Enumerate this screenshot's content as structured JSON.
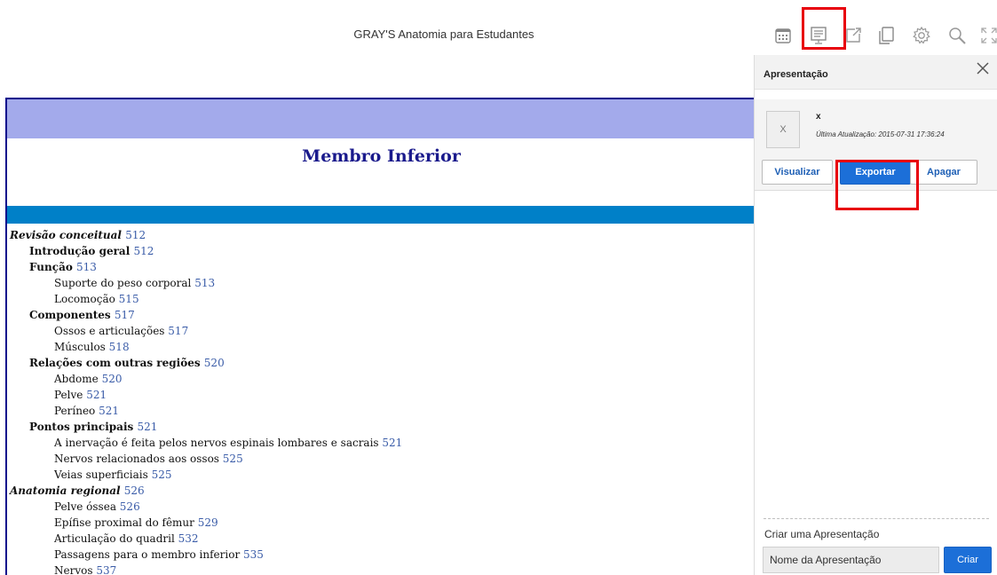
{
  "header": {
    "book_title": "GRAY'S Anatomia para Estudantes"
  },
  "toolbar": {
    "icons": [
      "calendar-icon",
      "presentation-icon",
      "share-icon",
      "copy-icon",
      "settings-icon",
      "search-icon",
      "fullscreen-icon"
    ],
    "highlight_color": "#e8000b"
  },
  "chapter": {
    "title": "Membro Inferior",
    "band_colors": {
      "lavender": "#a3aaeb",
      "blue": "#0080c8",
      "rule": "#0a0a8c"
    },
    "toc": [
      {
        "level": 0,
        "text": "Revisão conceitual",
        "page": "512"
      },
      {
        "level": 1,
        "text": "Introdução geral",
        "page": "512"
      },
      {
        "level": 1,
        "text": "Função",
        "page": "513"
      },
      {
        "level": 2,
        "text": "Suporte do peso corporal",
        "page": "513"
      },
      {
        "level": 2,
        "text": "Locomoção",
        "page": "515"
      },
      {
        "level": 1,
        "text": "Componentes",
        "page": "517"
      },
      {
        "level": 2,
        "text": "Ossos e articulações",
        "page": "517"
      },
      {
        "level": 2,
        "text": "Músculos",
        "page": "518"
      },
      {
        "level": 1,
        "text": "Relações com outras regiões",
        "page": "520"
      },
      {
        "level": 2,
        "text": "Abdome",
        "page": "520"
      },
      {
        "level": 2,
        "text": "Pelve",
        "page": "521"
      },
      {
        "level": 2,
        "text": "Períneo",
        "page": "521"
      },
      {
        "level": 1,
        "text": "Pontos principais",
        "page": "521"
      },
      {
        "level": 2,
        "text": "A inervação é feita pelos nervos espinais lombares e sacrais",
        "page": "521"
      },
      {
        "level": 2,
        "text": "Nervos relacionados aos ossos",
        "page": "525"
      },
      {
        "level": 2,
        "text": "Veias superficiais",
        "page": "525"
      },
      {
        "level": 0,
        "text": "Anatomia regional",
        "page": "526"
      },
      {
        "level": 2,
        "text": "Pelve óssea",
        "page": "526"
      },
      {
        "level": 2,
        "text": "Epífise proximal do fêmur",
        "page": "529"
      },
      {
        "level": 2,
        "text": "Articulação do quadril",
        "page": "532"
      },
      {
        "level": 2,
        "text": "Passagens para o membro inferior",
        "page": "535"
      },
      {
        "level": 2,
        "text": "Nervos",
        "page": "537"
      }
    ]
  },
  "panel": {
    "title": "Apresentação",
    "presentation": {
      "thumb_label": "X",
      "name": "x",
      "updated": "Última Atualização: 2015-07-31 17:36:24"
    },
    "buttons": {
      "view": "Visualizar",
      "export": "Exportar",
      "delete": "Apagar"
    },
    "create": {
      "label": "Criar uma Apresentação",
      "input_value": "Nome da Apresentação",
      "button": "Criar"
    }
  }
}
